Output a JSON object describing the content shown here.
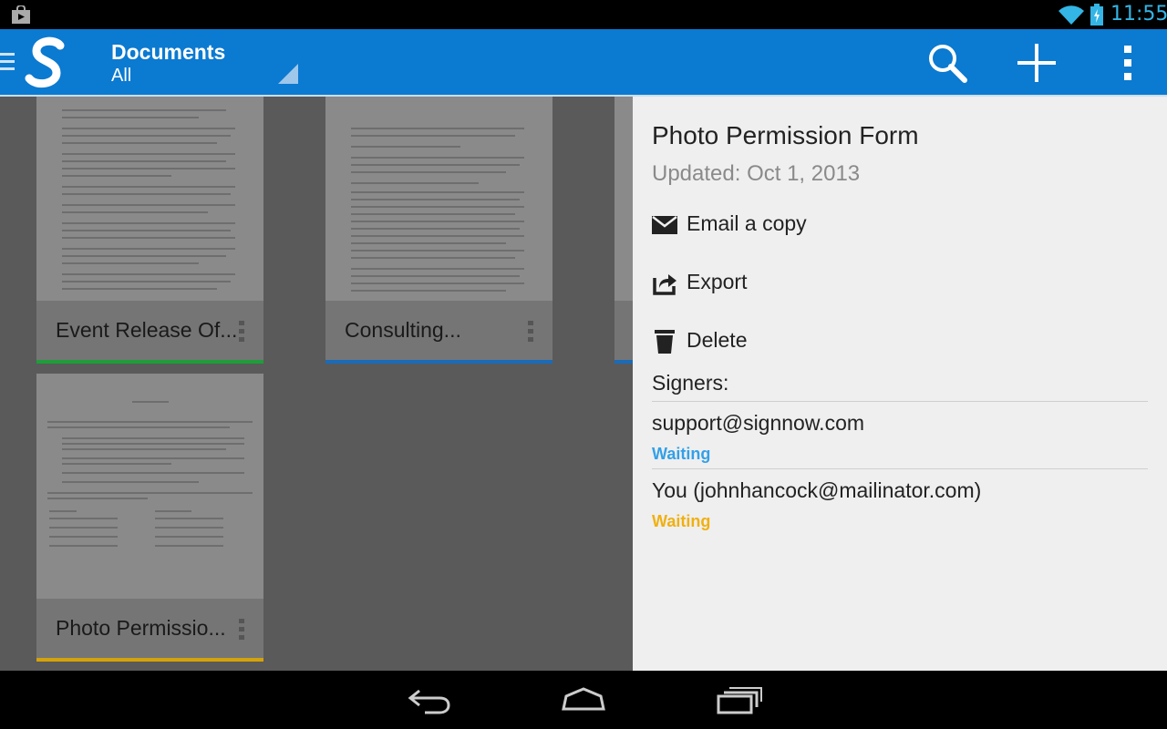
{
  "status_bar": {
    "time": "11:55"
  },
  "action_bar": {
    "title": "Documents",
    "filter": "All"
  },
  "documents": [
    {
      "label": "Event Release Of...",
      "accent": "#1e9e3a"
    },
    {
      "label": "Consulting...",
      "accent": "#1a6bb8"
    },
    {
      "label": "Photo Permissio...",
      "accent": "#d4a20a"
    }
  ],
  "detail_panel": {
    "title": "Photo Permission Form",
    "updated": "Updated: Oct 1, 2013",
    "actions": [
      {
        "label": "Email a copy",
        "icon": "envelope-icon"
      },
      {
        "label": "Export",
        "icon": "export-icon"
      },
      {
        "label": "Delete",
        "icon": "trash-icon"
      }
    ],
    "signers_heading": "Signers:",
    "signers": [
      {
        "email": "support@signnow.com",
        "status": "Waiting",
        "status_color": "#33a0e8"
      },
      {
        "email": "You (johnhancock@mailinator.com)",
        "status": "Waiting",
        "status_color": "#f0b010"
      }
    ]
  },
  "colors": {
    "action_bar": "#0b7ad1",
    "clock": "#33b5e5"
  }
}
